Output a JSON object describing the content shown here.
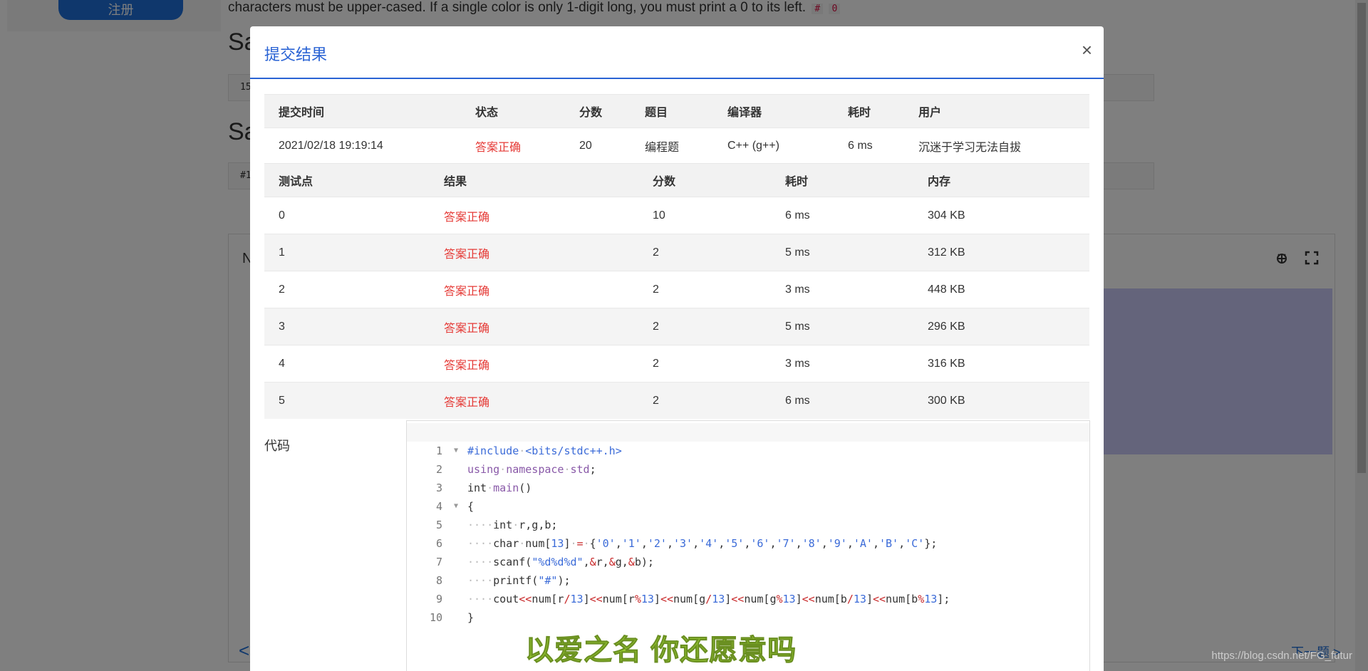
{
  "background": {
    "register_label": "注册",
    "problem_text": "characters must be upper-cased. If a single color is only 1-digit long, you must print a 0 to its left.",
    "code_chip_1": "#",
    "code_chip_2": "0",
    "heading_1": "Sa",
    "heading_2": "Sa",
    "input_prefix": "15",
    "output_prefix": "#1",
    "editor_letter": "N",
    "prev_arrow": "<",
    "next_label": "下一题 >"
  },
  "modal": {
    "title": "提交结果",
    "close_label": "×",
    "summary": {
      "headers": [
        "提交时间",
        "状态",
        "分数",
        "题目",
        "编译器",
        "耗时",
        "用户"
      ],
      "row": [
        "2021/02/18 19:19:14",
        "答案正确",
        "20",
        "编程题",
        "C++ (g++)",
        "6 ms",
        "沉迷于学习无法自拔"
      ]
    },
    "cases": {
      "headers": [
        "测试点",
        "结果",
        "分数",
        "耗时",
        "内存"
      ],
      "rows": [
        [
          "0",
          "答案正确",
          "10",
          "6 ms",
          "304 KB"
        ],
        [
          "1",
          "答案正确",
          "2",
          "5 ms",
          "312 KB"
        ],
        [
          "2",
          "答案正确",
          "2",
          "3 ms",
          "448 KB"
        ],
        [
          "3",
          "答案正确",
          "2",
          "5 ms",
          "296 KB"
        ],
        [
          "4",
          "答案正确",
          "2",
          "3 ms",
          "316 KB"
        ],
        [
          "5",
          "答案正确",
          "2",
          "6 ms",
          "300 KB"
        ]
      ]
    },
    "code_label": "代码",
    "code_lines": [
      "#include <bits/stdc++.h>",
      "using namespace std;",
      "int main()",
      "{",
      "    int r,g,b;",
      "    char num[13] = {'0','1','2','3','4','5','6','7','8','9','A','B','C'};",
      "    scanf(\"%d%d%d\",&r,&g,&b);",
      "    printf(\"#\");",
      "    cout<<num[r/13]<<num[r%13]<<num[g/13]<<num[g%13]<<num[b/13]<<num[b%13];",
      "}"
    ]
  },
  "overlay_caption": "以爱之名 你还愿意吗",
  "url_watermark": "https://blog.csdn.net/FG_futur",
  "colors": {
    "accent": "#2a63d4",
    "status_correct": "#e53935",
    "caption": "#9acd32"
  }
}
